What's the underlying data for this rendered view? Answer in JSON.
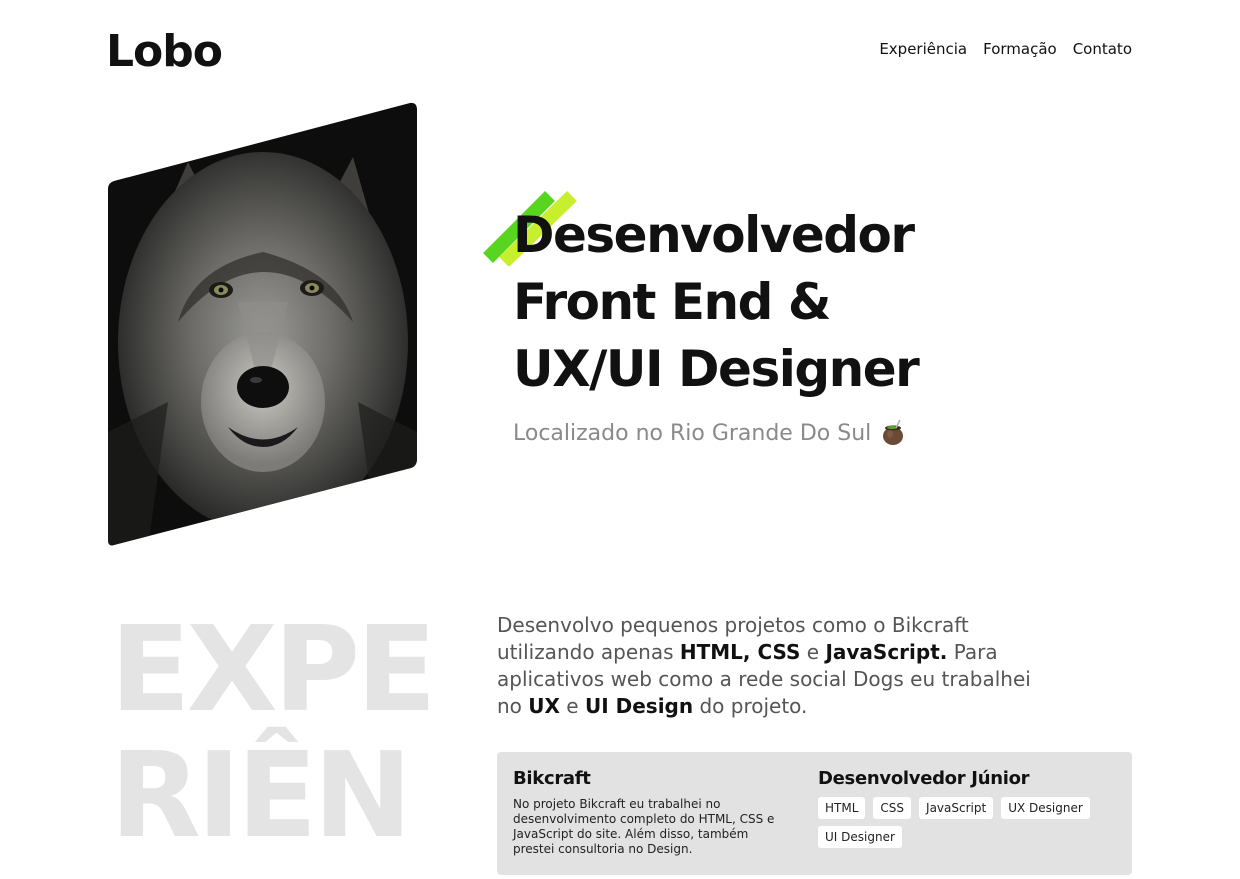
{
  "header": {
    "logo": "Lobo",
    "nav": [
      "Experiência",
      "Formação",
      "Contato"
    ]
  },
  "hero": {
    "image_alt": "wolf-portrait",
    "headline": [
      "Desenvolvedor",
      "Front End &",
      "UX/UI Designer"
    ],
    "location": "Localizado no Rio Grande Do Sul",
    "accent_colors": [
      "#58d51e",
      "#c8ef2e"
    ]
  },
  "experience": {
    "bg_word": [
      "EXPE",
      "RIÊN"
    ],
    "intro": {
      "p1": "Desenvolvo pequenos projetos como o Bikcraft utilizando apenas ",
      "b1": "HTML, CSS",
      "p2": " e ",
      "b2": "JavaScript.",
      "p3": " Para aplicativos web como a rede social Dogs eu trabalhei no ",
      "b3": "UX",
      "p4": " e ",
      "b4": "UI Design",
      "p5": " do projeto."
    },
    "card": {
      "title": "Bikcraft",
      "description": "No projeto Bikcraft eu trabalhei no desenvolvimento completo do HTML, CSS e JavaScript do site. Além disso, também prestei consultoria no Design.",
      "role": "Desenvolvedor Júnior",
      "tags": [
        "HTML",
        "CSS",
        "JavaScript",
        "UX Designer",
        "UI Designer"
      ]
    }
  }
}
